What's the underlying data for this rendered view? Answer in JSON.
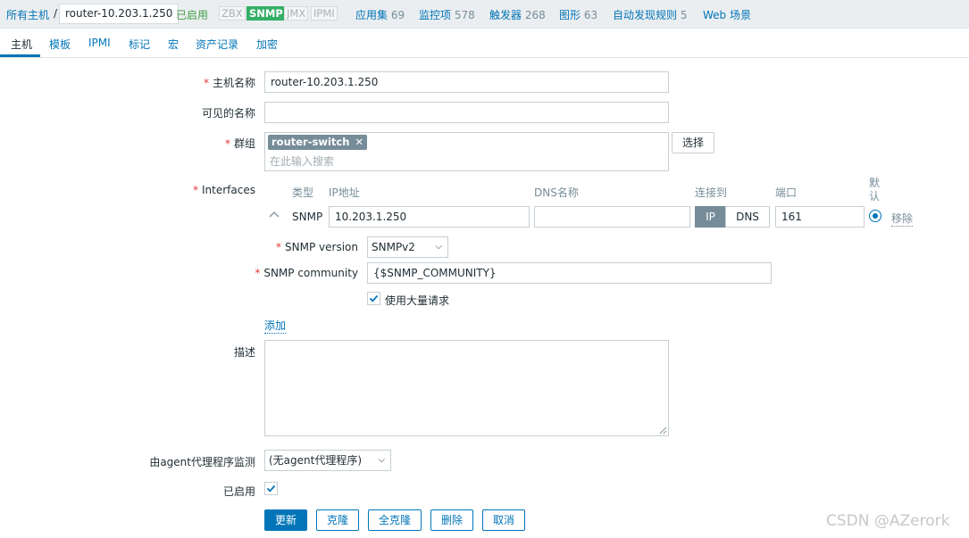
{
  "header": {
    "breadcrumb_root": "所有主机",
    "separator": "/",
    "current_host": "router-10.203.1.250",
    "status": "已启用",
    "availability": [
      {
        "label": "ZBX",
        "active": false
      },
      {
        "label": "SNMP",
        "active": true
      },
      {
        "label": "JMX",
        "active": false
      },
      {
        "label": "IPMI",
        "active": false
      }
    ],
    "links": [
      {
        "label": "应用集",
        "count": "69"
      },
      {
        "label": "监控项",
        "count": "578"
      },
      {
        "label": "触发器",
        "count": "268"
      },
      {
        "label": "图形",
        "count": "63"
      },
      {
        "label": "自动发现规则",
        "count": "5"
      },
      {
        "label": "Web 场景",
        "count": ""
      }
    ]
  },
  "tabs": [
    "主机",
    "模板",
    "IPMI",
    "标记",
    "宏",
    "资产记录",
    "加密"
  ],
  "form": {
    "host_name_label": "主机名称",
    "host_name_value": "router-10.203.1.250",
    "visible_name_label": "可见的名称",
    "visible_name_value": "",
    "groups_label": "群组",
    "group_tag": "router-switch",
    "group_tag_remove": "✕",
    "groups_placeholder": "在此输入搜索",
    "select_button": "选择",
    "interfaces_label": "Interfaces",
    "interface_columns": {
      "type": "类型",
      "ip": "IP地址",
      "dns": "DNS名称",
      "connect": "连接到",
      "port": "端口",
      "default": "默认"
    },
    "interface_row": {
      "type": "SNMP",
      "ip": "10.203.1.250",
      "dns": "",
      "connect_ip": "IP",
      "connect_dns": "DNS",
      "port": "161",
      "remove": "移除"
    },
    "snmp_version_label": "SNMP version",
    "snmp_version_value": "SNMPv2",
    "snmp_community_label": "SNMP community",
    "snmp_community_value": "{$SNMP_COMMUNITY}",
    "bulk_label": "使用大量请求",
    "bulk_checked": true,
    "add_link": "添加",
    "description_label": "描述",
    "description_value": "",
    "proxy_label": "由agent代理程序监测",
    "proxy_value": "(无agent代理程序)",
    "enabled_label": "已启用",
    "enabled_checked": true
  },
  "actions": {
    "update": "更新",
    "clone": "克隆",
    "full_clone": "全克隆",
    "delete": "删除",
    "cancel": "取消"
  },
  "watermark": "CSDN @AZerork",
  "colors": {
    "accent": "#0275b8",
    "enabled": "#429e47",
    "snmp_active": "#34af67",
    "required": "#e33734"
  }
}
